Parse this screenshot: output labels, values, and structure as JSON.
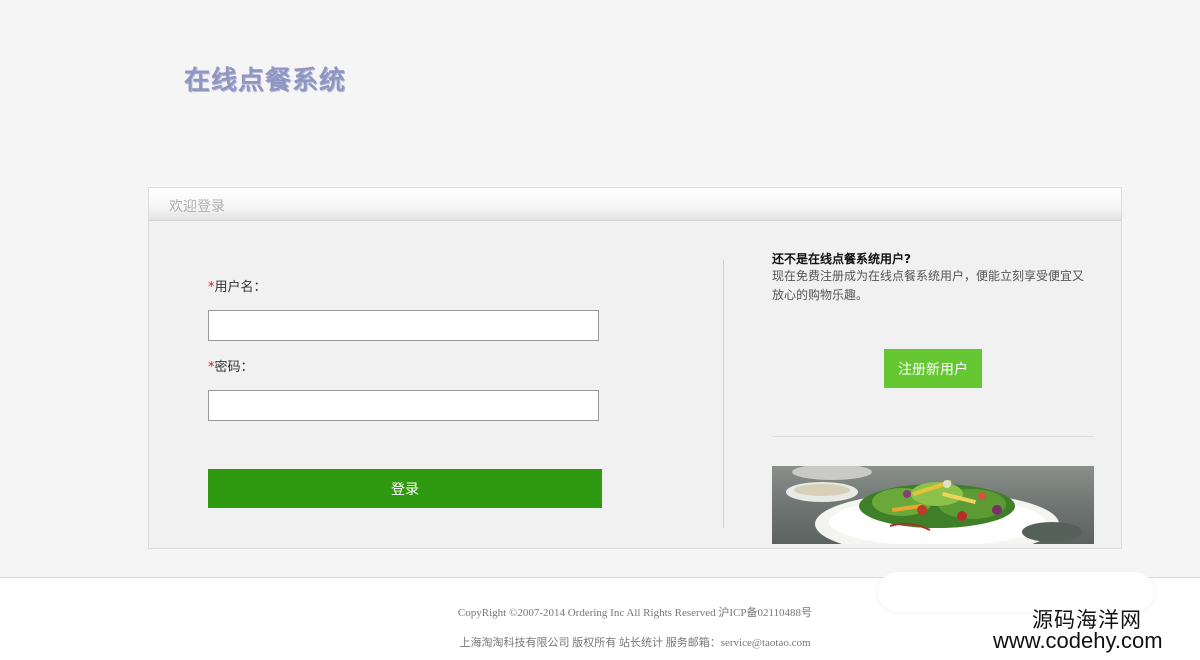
{
  "header": {
    "logo_text": "在线点餐系统"
  },
  "login": {
    "title": "欢迎登录",
    "required_mark": "*",
    "username_label": "用户名：",
    "username_value": "",
    "password_label": "密码：",
    "password_value": "",
    "submit_label": "登录"
  },
  "register": {
    "title": "还不是在线点餐系统用户?",
    "description": "现在免费注册成为在线点餐系统用户，便能立刻享受便宜又放心的购物乐趣。",
    "button_label": "注册新用户"
  },
  "footer": {
    "copyright": "CopyRight ©2007-2014 Ordering Inc All Rights Reserved 沪ICP备02110488号",
    "company": "上海淘淘科技有限公司 版权所有 站长统计 服务邮箱：service@taotao.com"
  },
  "watermark": {
    "name": "源码海洋网",
    "url": "www.codehy.com"
  },
  "colors": {
    "logo": "#8f96c2",
    "login_button": "#2f9a0f",
    "register_button": "#66c733",
    "required_mark": "#cc2222"
  }
}
